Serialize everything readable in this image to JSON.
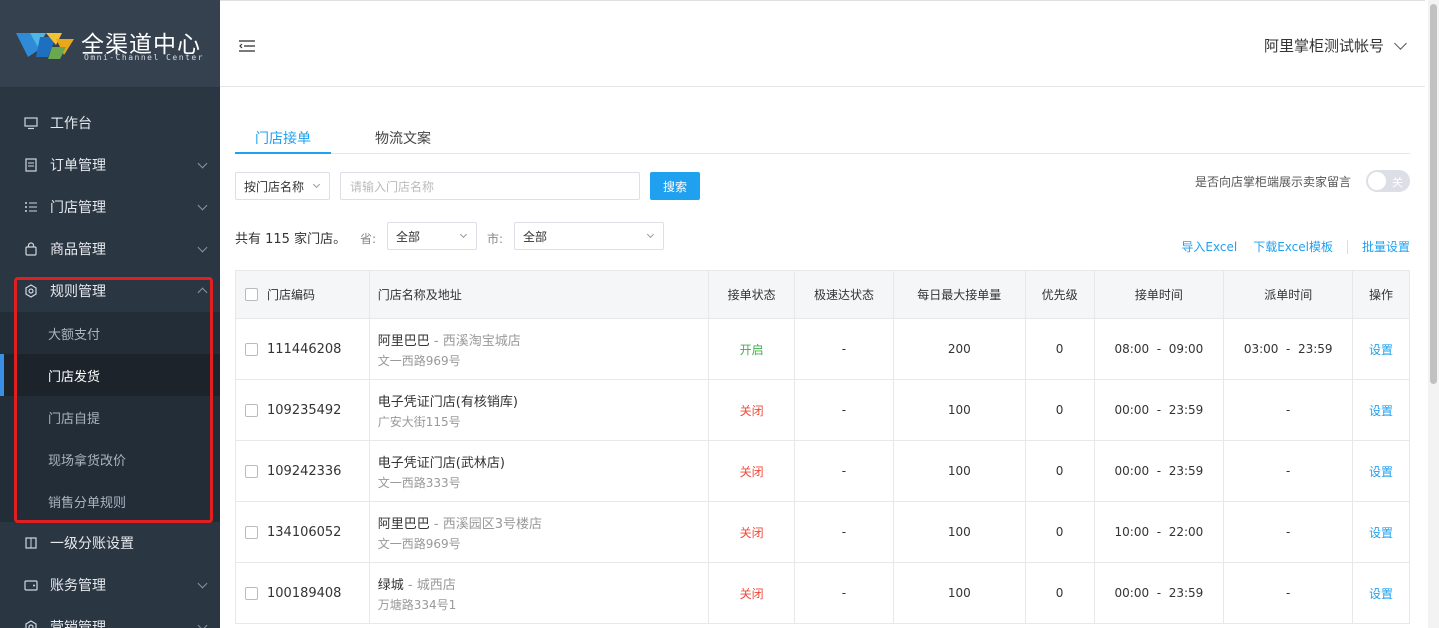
{
  "brand": {
    "title": "全渠道中心",
    "subtitle": "Omni-Channel Center"
  },
  "menu": [
    {
      "label": "工作台",
      "icon": "monitor-icon",
      "has_arrow": false
    },
    {
      "label": "订单管理",
      "icon": "order-icon",
      "has_arrow": true
    },
    {
      "label": "门店管理",
      "icon": "list-icon",
      "has_arrow": true
    },
    {
      "label": "商品管理",
      "icon": "bag-icon",
      "has_arrow": true
    },
    {
      "label": "规则管理",
      "icon": "gear-icon",
      "has_arrow": true,
      "expanded": true,
      "children": [
        "大额支付",
        "门店发货",
        "门店自提",
        "现场拿货改价",
        "销售分单规则"
      ],
      "active_child": "门店发货"
    },
    {
      "label": "一级分账设置",
      "icon": "book-icon",
      "has_arrow": false
    },
    {
      "label": "账务管理",
      "icon": "wallet-icon",
      "has_arrow": true
    },
    {
      "label": "营销管理",
      "icon": "gear-icon",
      "has_arrow": true
    }
  ],
  "header": {
    "account": "阿里掌柜测试帐号"
  },
  "tabs": [
    "门店接单",
    "物流文案"
  ],
  "active_tab": "门店接单",
  "filter": {
    "search_type": "按门店名称",
    "search_placeholder": "请输入门店名称",
    "search_button": "搜索"
  },
  "toggle": {
    "label": "是否向店掌柜端展示卖家留言",
    "state": "关"
  },
  "summary": {
    "count_text": "共有 115 家门店。",
    "province_label": "省:",
    "province_value": "全部",
    "city_label": "市:",
    "city_value": "全部"
  },
  "actions": {
    "import": "导入Excel",
    "download": "下载Excel模板",
    "batch": "批量设置"
  },
  "table": {
    "headers": [
      "门店编码",
      "门店名称及地址",
      "接单状态",
      "极速达状态",
      "每日最大接单量",
      "优先级",
      "接单时间",
      "派单时间",
      "操作"
    ],
    "rows": [
      {
        "code": "111446208",
        "name": "阿里巴巴",
        "branch": " - 西溪淘宝城店",
        "addr": "文一西路969号",
        "status": "开启",
        "fast": "-",
        "max": "200",
        "priority": "0",
        "accept": "08:00  -  09:00",
        "dispatch": "03:00  -  23:59",
        "op": "设置"
      },
      {
        "code": "109235492",
        "name": "电子凭证门店(有核销库)",
        "branch": "",
        "addr": "广安大街115号",
        "status": "关闭",
        "fast": "-",
        "max": "100",
        "priority": "0",
        "accept": "00:00  -  23:59",
        "dispatch": "-",
        "op": "设置"
      },
      {
        "code": "109242336",
        "name": "电子凭证门店(武林店)",
        "branch": "",
        "addr": "文一西路333号",
        "status": "关闭",
        "fast": "-",
        "max": "100",
        "priority": "0",
        "accept": "00:00  -  23:59",
        "dispatch": "-",
        "op": "设置"
      },
      {
        "code": "134106052",
        "name": "阿里巴巴",
        "branch": " - 西溪园区3号楼店",
        "addr": "文一西路969号",
        "status": "关闭",
        "fast": "-",
        "max": "100",
        "priority": "0",
        "accept": "10:00  -  22:00",
        "dispatch": "-",
        "op": "设置"
      },
      {
        "code": "100189408",
        "name": "绿城",
        "branch": " - 城西店",
        "addr": "万塘路334号1",
        "status": "关闭",
        "fast": "-",
        "max": "100",
        "priority": "0",
        "accept": "00:00  -  23:59",
        "dispatch": "-",
        "op": "设置"
      }
    ]
  },
  "colors": {
    "sidebar": "#2b3643",
    "accent": "#1fa1f0",
    "on": "#3cb34a",
    "off": "#f04a3a"
  }
}
